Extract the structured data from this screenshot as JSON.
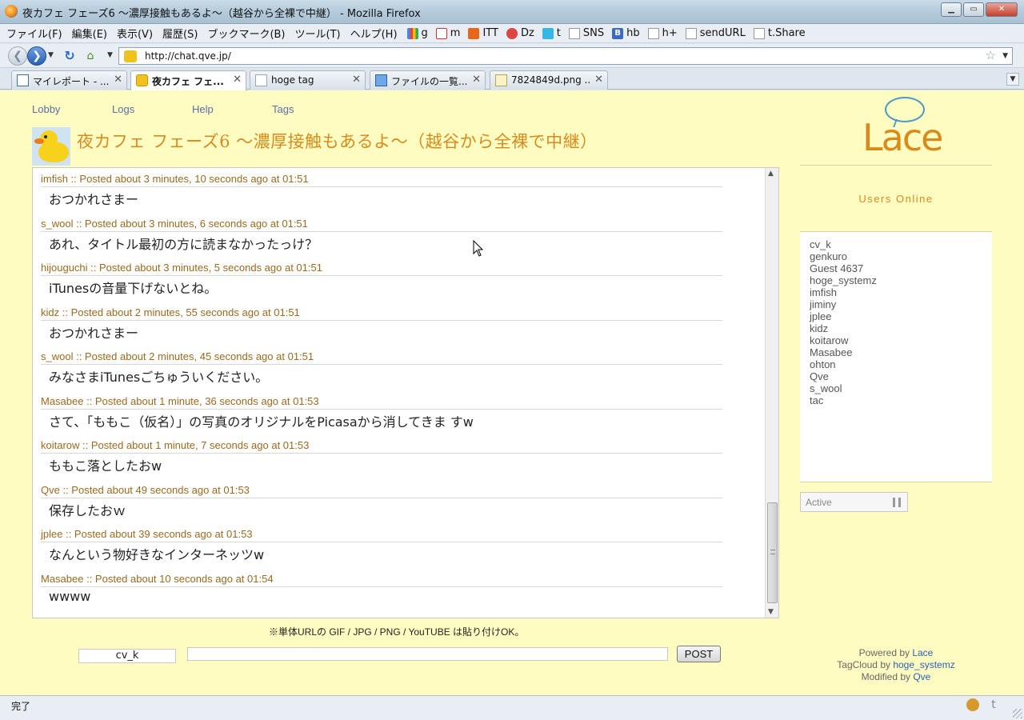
{
  "window": {
    "title": "夜カフェ フェーズ6 ～濃厚接触もあるよ～（越谷から全裸で中継） - Mozilla Firefox",
    "minimize": "▁",
    "maximize": "▭",
    "close": "✕"
  },
  "menu": {
    "items": [
      "ファイル(F)",
      "編集(E)",
      "表示(V)",
      "履歴(S)",
      "ブックマーク(B)",
      "ツール(T)",
      "ヘルプ(H)"
    ],
    "bookmarks": [
      {
        "label": "g",
        "icon": "google-icon"
      },
      {
        "label": "m",
        "icon": "gmail-icon"
      },
      {
        "label": "ITT",
        "icon": "itt-icon"
      },
      {
        "label": "Dz",
        "icon": "dz-icon"
      },
      {
        "label": "t",
        "icon": "twitter-icon"
      },
      {
        "label": "SNS",
        "icon": "page-icon"
      },
      {
        "label": "hb",
        "icon": "hatena-bookmark-icon"
      },
      {
        "label": "h+",
        "icon": "page-icon"
      },
      {
        "label": "sendURL",
        "icon": "page-icon"
      },
      {
        "label": "t.Share",
        "icon": "page-icon"
      }
    ]
  },
  "nav": {
    "url": "http://chat.qve.jp/"
  },
  "tabs": [
    {
      "label": "マイレポート - ...",
      "icon": "chart",
      "active": false
    },
    {
      "label": "夜カフェ フェ...",
      "icon": "duck",
      "active": true
    },
    {
      "label": "hoge tag",
      "icon": "page",
      "active": false
    },
    {
      "label": "ファイルの一覧...",
      "icon": "blue",
      "active": false
    },
    {
      "label": "7824849d.png ...",
      "icon": "img",
      "active": false
    }
  ],
  "site": {
    "nav_links": [
      "Lobby",
      "Logs",
      "Help",
      "Tags"
    ],
    "room_title": "夜カフェ フェーズ6 ～濃厚接触もあるよ～（越谷から全裸で中継）",
    "logo_text": "Lace"
  },
  "messages": [
    {
      "nick": "imfish",
      "meta": " :: Posted about 3 minutes, 10 seconds ago at 01:51",
      "text": "おつかれさまー"
    },
    {
      "nick": "s_wool",
      "meta": " :: Posted about 3 minutes, 6 seconds ago at 01:51",
      "text": "あれ、タイトル最初の方に読まなかったっけ？"
    },
    {
      "nick": "hijouguchi",
      "meta": " :: Posted about 3 minutes, 5 seconds ago at 01:51",
      "text": "iTunesの音量下げないとね。"
    },
    {
      "nick": "kidz",
      "meta": " :: Posted about 2 minutes, 55 seconds ago at 01:51",
      "text": "おつかれさまー"
    },
    {
      "nick": "s_wool",
      "meta": " :: Posted about 2 minutes, 45 seconds ago at 01:51",
      "text": "みなさまiTunesごちゅういください。"
    },
    {
      "nick": "Masabee",
      "meta": " :: Posted about 1 minute, 36 seconds ago at 01:53",
      "text": "さて、「ももこ（仮名）」の写真のオリジナルをPicasaから消してきま すw"
    },
    {
      "nick": "koitarow",
      "meta": " :: Posted about 1 minute, 7 seconds ago at 01:53",
      "text": "ももこ落としたおw"
    },
    {
      "nick": "Qve",
      "meta": " :: Posted about 49 seconds ago at 01:53",
      "text": "保存したおｗ"
    },
    {
      "nick": "jplee",
      "meta": " :: Posted about 39 seconds ago at 01:53",
      "text": "なんという物好きなインターネッツw"
    },
    {
      "nick": "Masabee",
      "meta": " :: Posted about 10 seconds ago at 01:54",
      "text": "wwww"
    }
  ],
  "notice": "※単体URLの GIF / JPG / PNG / YouTUBE は貼り付けOK。",
  "form": {
    "nickname": "cv_k",
    "message": "",
    "post_label": "POST"
  },
  "sidebar": {
    "users_title": "Users Online",
    "users": [
      "cv_k",
      "genkuro",
      "Guest 4637",
      "hoge_systemz",
      "imfish",
      "jiminy",
      "jplee",
      "kidz",
      "koitarow",
      "Masabee",
      "ohton",
      "Qve",
      "s_wool",
      "tac"
    ],
    "status_label": "Active"
  },
  "credits": {
    "powered_prefix": "Powered by ",
    "powered_link": "Lace",
    "tagcloud_prefix": "TagCloud by ",
    "tagcloud_link": "hoge_systemz",
    "modified_prefix": "Modified by ",
    "modified_link": "Qve"
  },
  "status": {
    "text": "完了"
  }
}
